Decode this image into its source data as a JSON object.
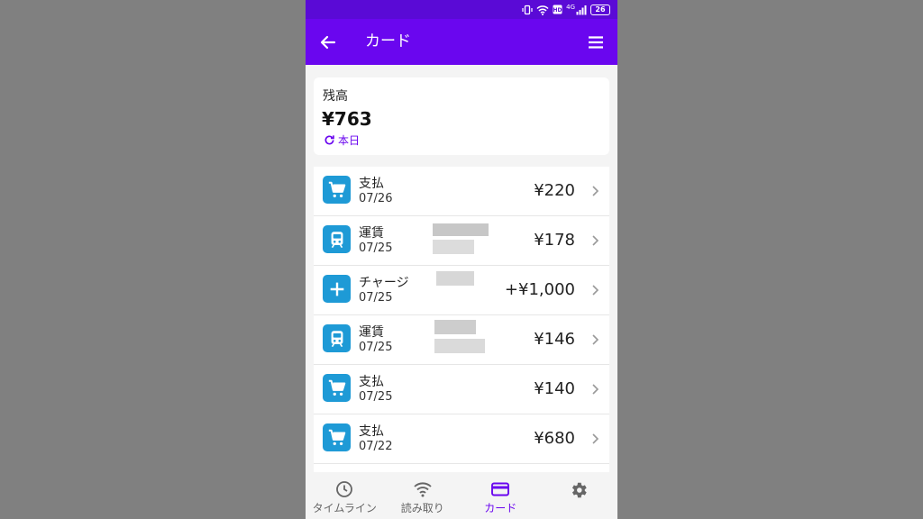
{
  "status_bar": {
    "network": "4G",
    "battery": "26"
  },
  "app_bar": {
    "title": "カード"
  },
  "balance": {
    "label": "残高",
    "amount": "¥763",
    "refresh_label": "本日"
  },
  "transactions": [
    {
      "type": "支払",
      "date": "07/26",
      "amount": "¥220",
      "icon": "cart-icon"
    },
    {
      "type": "運賃",
      "date": "07/25",
      "amount": "¥178",
      "icon": "train-icon"
    },
    {
      "type": "チャージ",
      "date": "07/25",
      "amount": "+¥1,000",
      "icon": "plus-icon"
    },
    {
      "type": "運賃",
      "date": "07/25",
      "amount": "¥146",
      "icon": "train-icon"
    },
    {
      "type": "支払",
      "date": "07/25",
      "amount": "¥140",
      "icon": "cart-icon"
    },
    {
      "type": "支払",
      "date": "07/22",
      "amount": "¥680",
      "icon": "cart-icon"
    }
  ],
  "bottom_nav": {
    "items": [
      {
        "label": "タイムライン",
        "icon": "clock-icon"
      },
      {
        "label": "読み取り",
        "icon": "wifi-icon"
      },
      {
        "label": "カード",
        "icon": "card-icon",
        "active": true
      },
      {
        "label": "",
        "icon": "gear-icon"
      }
    ]
  },
  "colors": {
    "status_bar": "#5a0ad6",
    "app_bar": "#6a06ef",
    "accent": "#6a06ef",
    "icon_bg": "#1e9ad6",
    "background": "#f4f4f4"
  }
}
